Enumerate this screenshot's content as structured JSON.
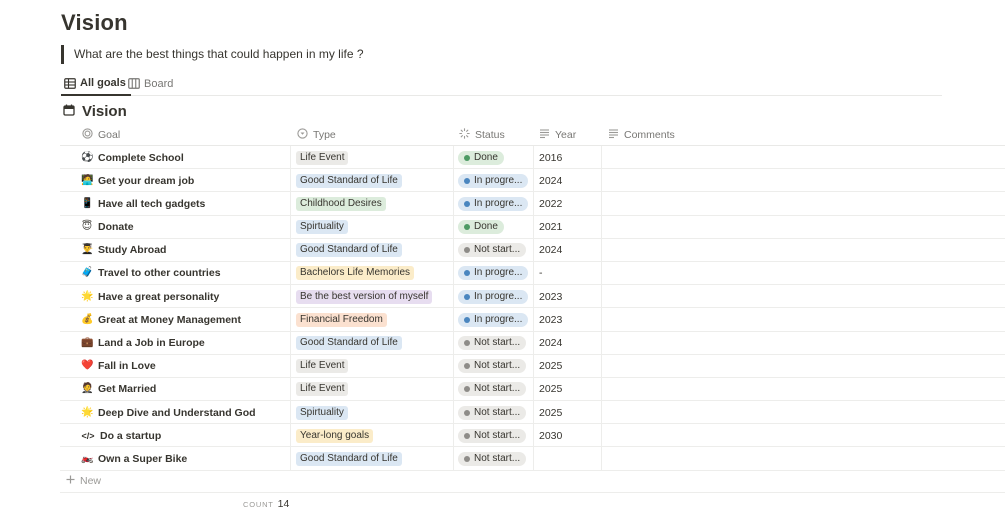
{
  "page": {
    "title": "Vision",
    "quote": "What are the best things that could happen in my life ?"
  },
  "tabs": [
    {
      "label": "All goals",
      "icon": "table-icon",
      "active": true
    },
    {
      "label": "Board",
      "icon": "board-icon",
      "active": false
    }
  ],
  "database": {
    "title": "Vision",
    "icon": "calendar-icon"
  },
  "columns": {
    "goal": "Goal",
    "type": "Type",
    "status": "Status",
    "year": "Year",
    "comments": "Comments"
  },
  "colors": {
    "life_event": "#ebeae7",
    "good_standard": "#dbe7f3",
    "childhood": "#dcecdc",
    "spirituality": "#dbe7f3",
    "bachelors": "#fbecc9",
    "best_version": "#e7ddf0",
    "financial": "#fbe1d0",
    "year_long": "#fbecc9",
    "done_bg": "#dcecdc",
    "done_dot": "#4d9a63",
    "progress_bg": "#dbe7f3",
    "progress_dot": "#4a86bf",
    "notstarted_bg": "#ebeae7",
    "notstarted_dot": "#8e8c88"
  },
  "rows": [
    {
      "emoji": "⚽",
      "goal": "Complete School",
      "type": "Life Event",
      "type_color": "#ebeae7",
      "status": "Done",
      "status_kind": "done",
      "year": "2016"
    },
    {
      "emoji": "🧑‍💻",
      "goal": "Get your dream job",
      "type": "Good Standard of Life",
      "type_color": "#dbe7f3",
      "status": "In progre...",
      "status_kind": "progress",
      "year": "2024"
    },
    {
      "emoji": "📱",
      "goal": "Have all tech gadgets",
      "type": "Childhood Desires",
      "type_color": "#dcecdc",
      "status": "In progre...",
      "status_kind": "progress",
      "year": "2022"
    },
    {
      "emoji": "😇",
      "goal": "Donate",
      "type": "Spirtuality",
      "type_color": "#dbe7f3",
      "status": "Done",
      "status_kind": "done",
      "year": "2021"
    },
    {
      "emoji": "👨‍🎓",
      "goal": "Study Abroad",
      "type": "Good Standard of Life",
      "type_color": "#dbe7f3",
      "status": "Not start...",
      "status_kind": "notstarted",
      "year": "2024"
    },
    {
      "emoji": "🧳",
      "goal": "Travel to other countries",
      "type": "Bachelors Life Memories",
      "type_color": "#fbecc9",
      "status": "In progre...",
      "status_kind": "progress",
      "year": "-"
    },
    {
      "emoji": "🌟",
      "goal": "Have a great personality",
      "type": "Be the best version of myself",
      "type_color": "#e7ddf0",
      "status": "In progre...",
      "status_kind": "progress",
      "year": "2023"
    },
    {
      "emoji": "💰",
      "goal": "Great at Money Management",
      "type": "Financial Freedom",
      "type_color": "#fbe1d0",
      "status": "In progre...",
      "status_kind": "progress",
      "year": "2023"
    },
    {
      "emoji": "💼",
      "goal": "Land a Job in Europe",
      "type": "Good Standard of Life",
      "type_color": "#dbe7f3",
      "status": "Not start...",
      "status_kind": "notstarted",
      "year": "2024"
    },
    {
      "emoji": "❤️",
      "goal": "Fall in Love",
      "type": "Life Event",
      "type_color": "#ebeae7",
      "status": "Not start...",
      "status_kind": "notstarted",
      "year": "2025"
    },
    {
      "emoji": "🤵",
      "goal": "Get Married",
      "type": "Life Event",
      "type_color": "#ebeae7",
      "status": "Not start...",
      "status_kind": "notstarted",
      "year": "2025"
    },
    {
      "emoji": "🌟",
      "goal": "Deep Dive and Understand God",
      "type": "Spirtuality",
      "type_color": "#dbe7f3",
      "status": "Not start...",
      "status_kind": "notstarted",
      "year": "2025"
    },
    {
      "emoji": "</>",
      "goal": "Do a startup",
      "type": "Year-long goals",
      "type_color": "#fbecc9",
      "status": "Not start...",
      "status_kind": "notstarted",
      "year": "2030"
    },
    {
      "emoji": "🏍️",
      "goal": "Own a Super Bike",
      "type": "Good Standard of Life",
      "type_color": "#dbe7f3",
      "status": "Not start...",
      "status_kind": "notstarted",
      "year": ""
    }
  ],
  "new_label": "New",
  "count": {
    "label": "COUNT",
    "value": "14"
  }
}
